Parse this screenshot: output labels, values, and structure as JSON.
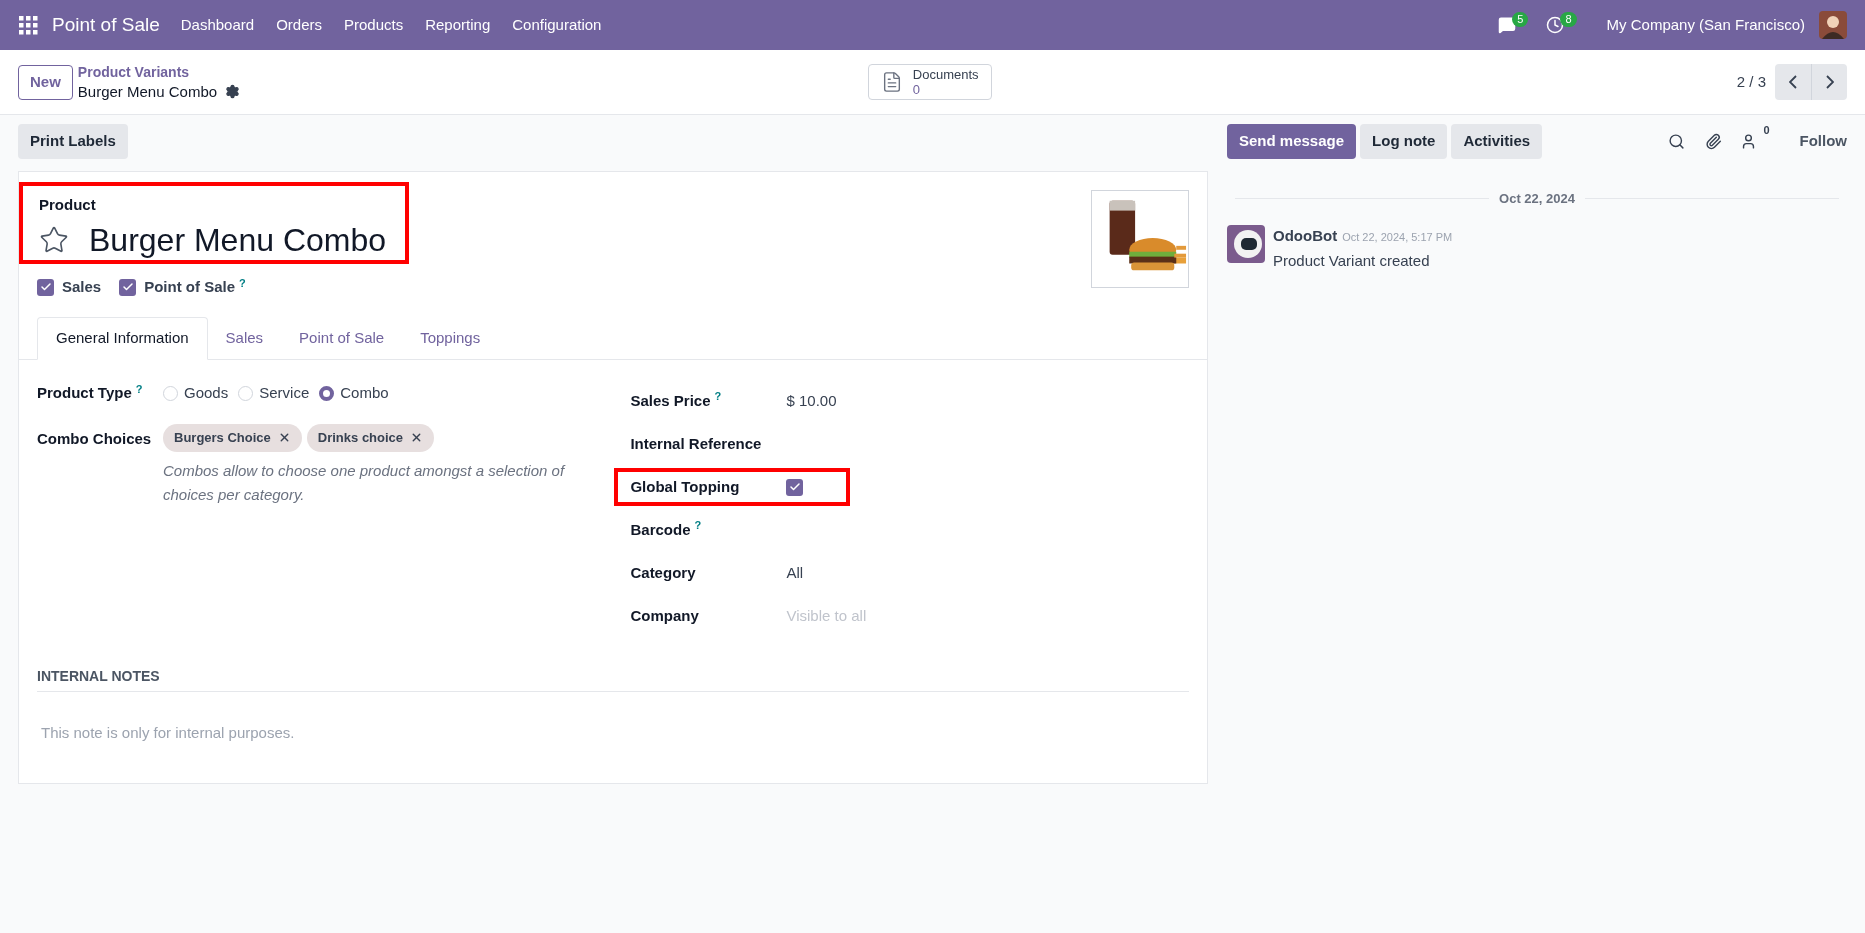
{
  "navbar": {
    "app_name": "Point of Sale",
    "menu": [
      "Dashboard",
      "Orders",
      "Products",
      "Reporting",
      "Configuration"
    ],
    "messages_count": "5",
    "activities_count": "8",
    "company": "My Company (San Francisco)"
  },
  "control_panel": {
    "new_button": "New",
    "breadcrumb": "Product Variants",
    "record_title": "Burger Menu Combo",
    "documents": {
      "label": "Documents",
      "count": "0"
    },
    "pager": "2 / 3"
  },
  "action_buttons": [
    "Print Labels"
  ],
  "form": {
    "name_label": "Product",
    "name": "Burger Menu Combo",
    "favorite": false,
    "name_highlighted": true,
    "options": [
      {
        "label": "Sales",
        "checked": true
      },
      {
        "label": "Point of Sale",
        "checked": true,
        "help": "?"
      }
    ],
    "tabs": [
      {
        "label": "General Information",
        "selected": true
      },
      {
        "label": "Sales",
        "selected": false
      },
      {
        "label": "Point of Sale",
        "selected": false
      },
      {
        "label": "Toppings",
        "selected": false
      }
    ],
    "product_type": {
      "label": "Product Type",
      "help": "?",
      "options": [
        {
          "label": "Goods",
          "selected": false
        },
        {
          "label": "Service",
          "selected": false
        },
        {
          "label": "Combo",
          "selected": true
        }
      ]
    },
    "combo_choices": {
      "label": "Combo Choices",
      "tags": [
        "Burgers Choice",
        "Drinks choice"
      ],
      "hint": "Combos allow to choose one product amongst a selection of choices per category."
    },
    "right_fields": [
      {
        "kind": "text",
        "label": "Sales Price",
        "help": "?",
        "value": "$ 10.00",
        "highlighted": false
      },
      {
        "kind": "text",
        "label": "Internal Reference",
        "highlighted": false
      },
      {
        "kind": "checkbox",
        "label": "Global Topping",
        "checked": true,
        "highlighted": true
      },
      {
        "kind": "text",
        "label": "Barcode",
        "help": "?",
        "highlighted": false
      },
      {
        "kind": "text",
        "label": "Category",
        "value": "All",
        "highlighted": false
      },
      {
        "kind": "text",
        "label": "Company",
        "placeholder": "Visible to all",
        "highlighted": false
      }
    ],
    "notes": {
      "title": "INTERNAL NOTES",
      "placeholder": "This note is only for internal purposes."
    }
  },
  "chatter": {
    "buttons": [
      {
        "label": "Send message",
        "selected": true
      },
      {
        "label": "Log note",
        "selected": false
      },
      {
        "label": "Activities",
        "selected": false
      }
    ],
    "followers_count": "0",
    "follow": "Follow",
    "date": "Oct 22, 2024",
    "messages": [
      {
        "author": "OdooBot",
        "time": "Oct 22, 2024, 5:17 PM",
        "body": "Product Variant created"
      }
    ]
  }
}
